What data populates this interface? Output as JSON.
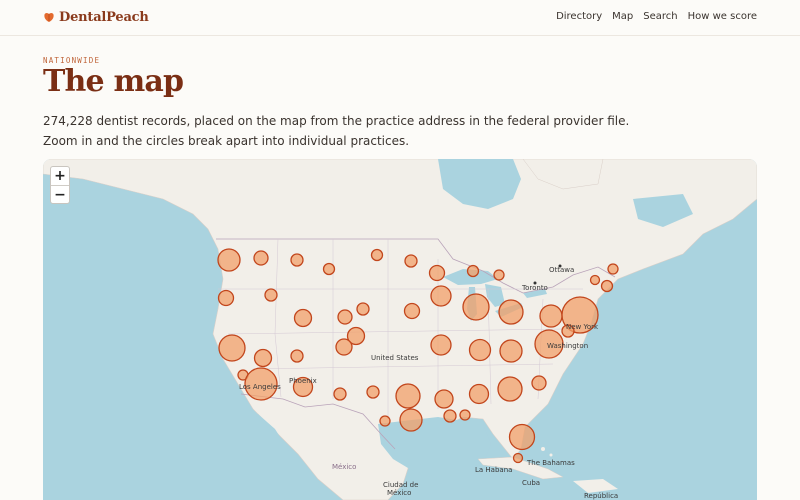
{
  "brand": {
    "name": "DentalPeach"
  },
  "nav": {
    "items": [
      "Directory",
      "Map",
      "Search",
      "How we score"
    ]
  },
  "hero": {
    "eyebrow": "NATIONWIDE",
    "title": "The map",
    "line1": "274,228 dentist records, placed on the map from the practice address in the federal provider file.",
    "line2": "Zoom in and the circles break apart into individual practices."
  },
  "map": {
    "zoom_in_label": "+",
    "zoom_out_label": "−",
    "labels": {
      "ottawa": "Ottawa",
      "toronto": "Toronto",
      "new_york": "New York",
      "washington": "Washington",
      "united_states": "United States",
      "phoenix": "Phoenix",
      "los_angeles": "Los Angeles",
      "mexico": "México",
      "ciudad_de_mexico_1": "Ciudad de",
      "ciudad_de_mexico_2": "México",
      "la_habana": "La Habana",
      "bahamas": "The Bahamas",
      "cuba": "Cuba",
      "republica": "República"
    },
    "colors": {
      "water": "#aad3df",
      "land": "#f2efe9",
      "circle_fill": "#f2a06a",
      "circle_stroke": "#c2461c"
    }
  }
}
